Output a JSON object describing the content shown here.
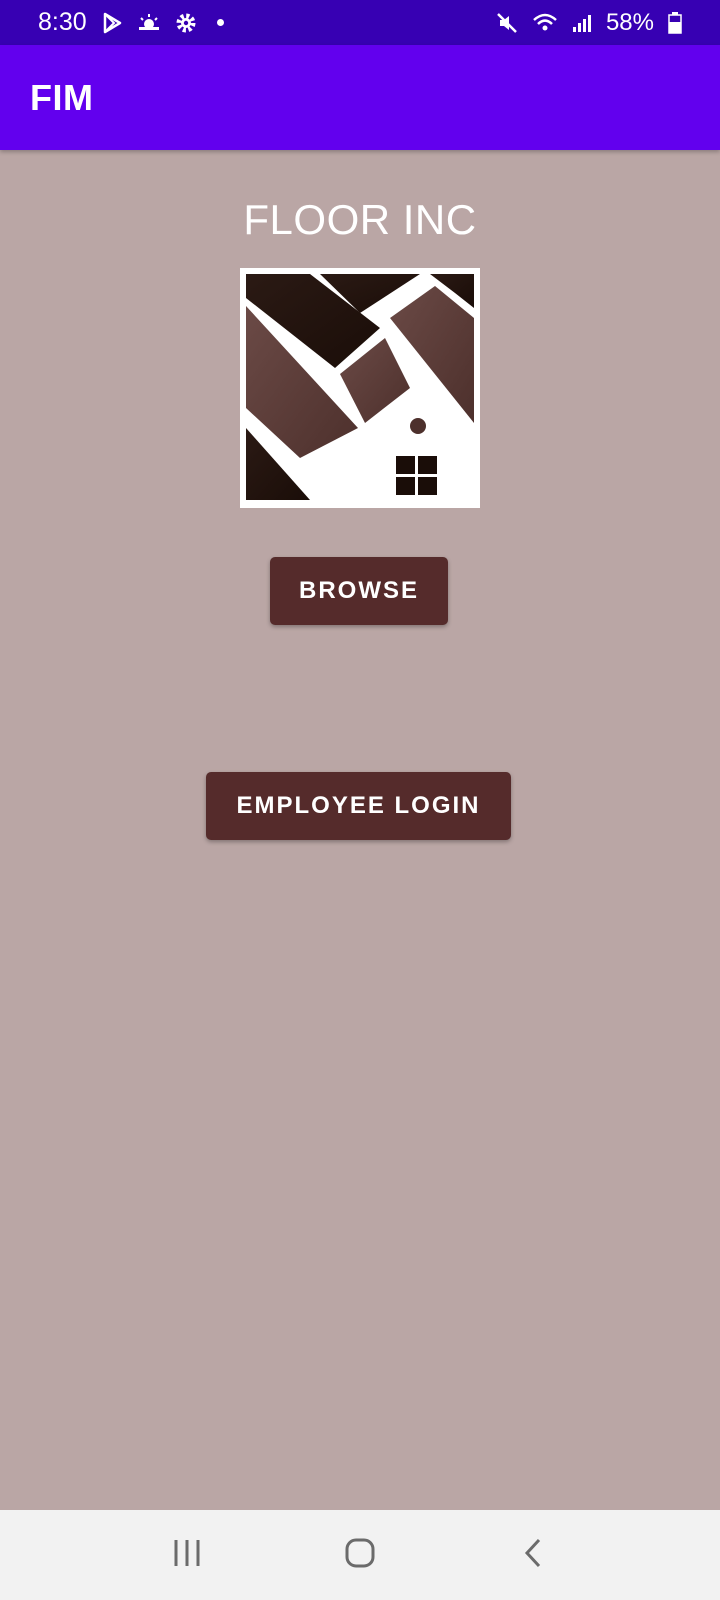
{
  "status_bar": {
    "time": "8:30",
    "battery": "58%",
    "icons": [
      "play-store-icon",
      "weather-icon",
      "settings-gear-icon",
      "notification-dot-icon",
      "mute-icon",
      "wifi-icon",
      "signal-icon",
      "battery-icon"
    ]
  },
  "app_bar": {
    "title": "FIM"
  },
  "main": {
    "company_name": "FLOOR INC",
    "logo_icon": "floor-inc-logo",
    "browse_label": "BROWSE",
    "employee_login_label": "EMPLOYEE LOGIN"
  },
  "nav_bar": {
    "icons": [
      "recent-apps-icon",
      "home-icon",
      "back-icon"
    ]
  },
  "colors": {
    "status_bar": "#3700b3",
    "app_bar": "#6200ee",
    "background": "#baa6a5",
    "button": "#552b2b"
  }
}
